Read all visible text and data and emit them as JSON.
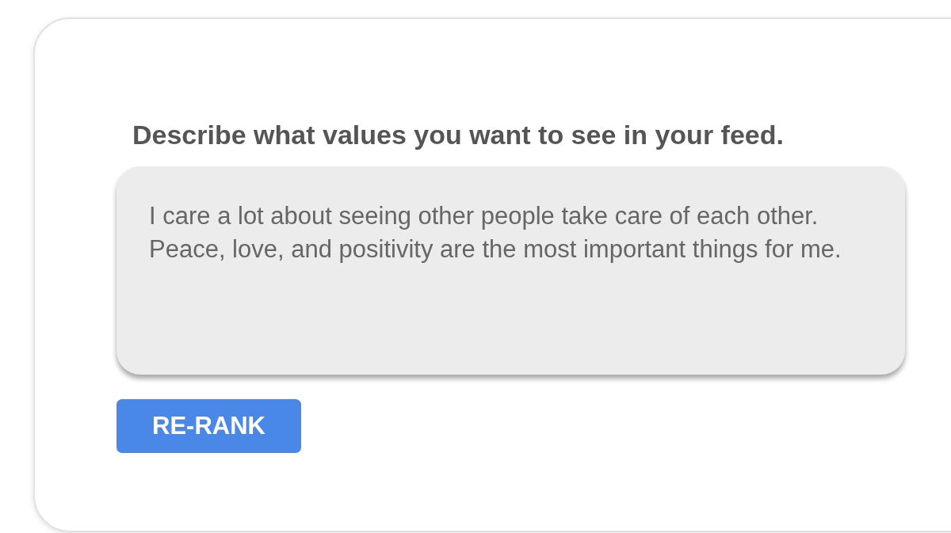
{
  "prompt": {
    "label": "Describe what values you want to see in your feed.",
    "value": "I care a lot about seeing other people take care of each other. Peace, love, and positivity are the most important things for me."
  },
  "button": {
    "label": "RE-RANK"
  }
}
